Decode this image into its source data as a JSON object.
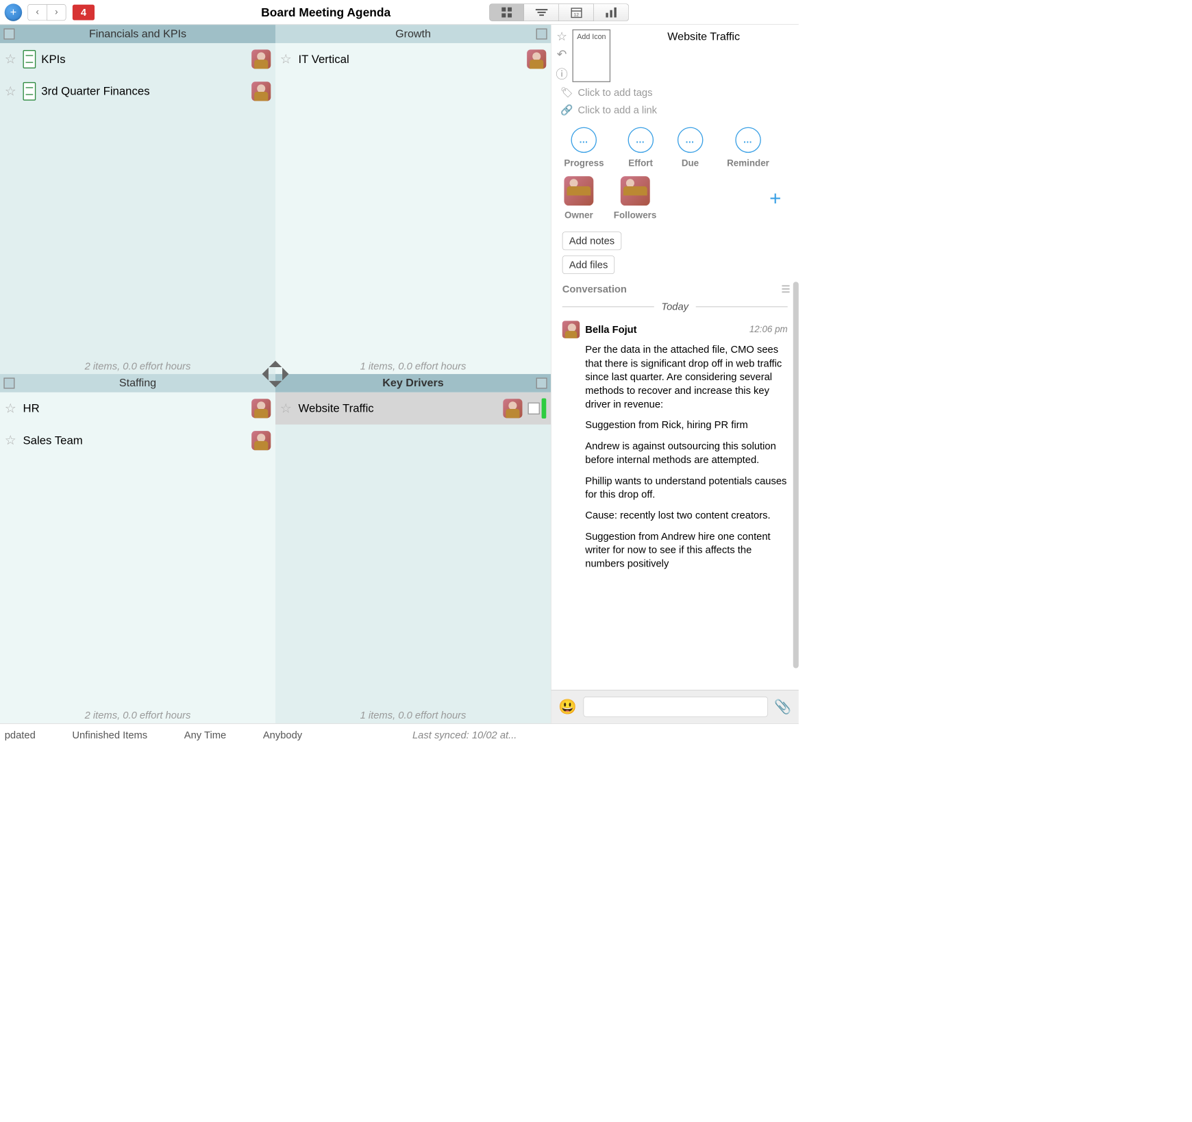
{
  "toolbar": {
    "count": "4",
    "title": "Board Meeting Agenda"
  },
  "columns": [
    {
      "title": "Financials and KPIs",
      "summary": "2 items, 0.0 effort hours",
      "cards": [
        {
          "title": "KPIs",
          "hasFolder": true
        },
        {
          "title": "3rd Quarter Finances",
          "hasFolder": true
        }
      ]
    },
    {
      "title": "Growth",
      "summary": "1 items, 0.0 effort hours",
      "cards": [
        {
          "title": "IT Vertical"
        }
      ]
    },
    {
      "title": "Staffing",
      "summary": "2 items, 0.0 effort hours",
      "cards": [
        {
          "title": "HR"
        },
        {
          "title": "Sales Team"
        }
      ]
    },
    {
      "title": "Key Drivers",
      "summary": "1 items, 0.0 effort hours",
      "cards": [
        {
          "title": "Website Traffic",
          "selected": true
        }
      ]
    }
  ],
  "panel": {
    "title": "Website Traffic",
    "addIcon": "Add Icon",
    "tagsPlaceholder": "Click to add tags",
    "linkPlaceholder": "Click to add a link",
    "circles": [
      {
        "label": "Progress"
      },
      {
        "label": "Effort"
      },
      {
        "label": "Due"
      },
      {
        "label": "Reminder"
      }
    ],
    "owner": "Owner",
    "followers": "Followers",
    "addNotes": "Add notes",
    "addFiles": "Add files",
    "conversation": "Conversation",
    "today": "Today",
    "comment": {
      "author": "Bella Fojut",
      "time": "12:06 pm",
      "p1": "Per the data in the attached file, CMO sees that there is significant drop off in web traffic since last quarter. Are considering several methods to recover and increase this key driver in revenue:",
      "p2": "Suggestion from Rick, hiring PR firm",
      "p3": "Andrew is against outsourcing this solution before internal methods are attempted.",
      "p4": "Phillip wants to understand potentials causes for this drop off.",
      "p5": "Cause: recently lost two content creators.",
      "p6": "Suggestion from Andrew hire one content writer for now to see if this affects the numbers positively"
    }
  },
  "bottom": {
    "b1": "pdated",
    "b2": "Unfinished Items",
    "b3": "Any Time",
    "b4": "Anybody",
    "sync": "Last synced: 10/02 at..."
  }
}
